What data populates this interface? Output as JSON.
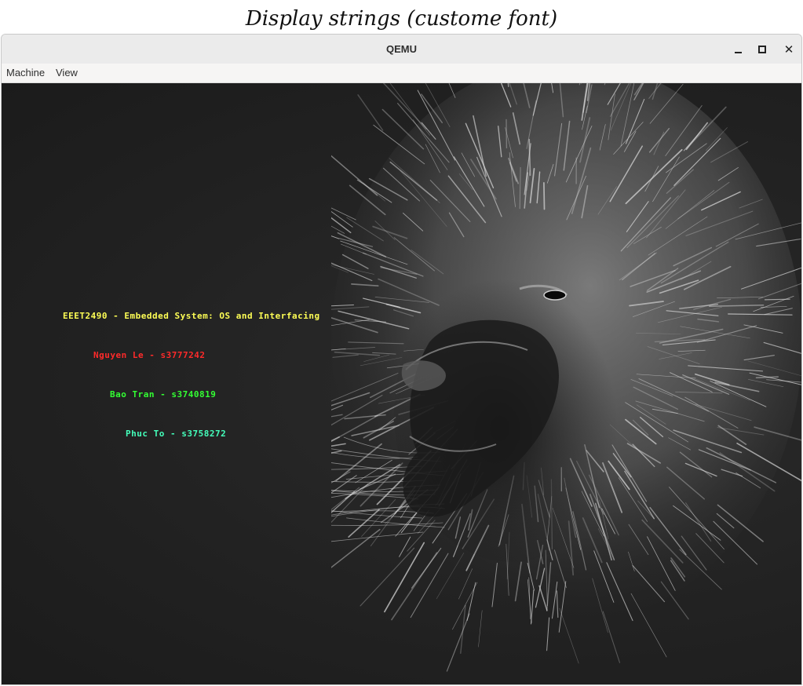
{
  "caption": "Display strings (custome font)",
  "window": {
    "title": "QEMU",
    "controls": {
      "minimize": "minimize-icon",
      "maximize": "maximize-icon",
      "close": "close-icon"
    }
  },
  "menu": {
    "machine": "Machine",
    "view": "View"
  },
  "screen": {
    "lines": [
      {
        "text": "EEET2490 - Embedded System: OS and Interfacing",
        "color": "#ffff55"
      },
      {
        "text": "Nguyen Le - s3777242",
        "color": "#ff2a2a"
      },
      {
        "text": "Bao Tran - s3740819",
        "color": "#33ff33"
      },
      {
        "text": "Phuc To - s3758272",
        "color": "#44ffbb"
      }
    ],
    "background_image": "lion-portrait"
  }
}
